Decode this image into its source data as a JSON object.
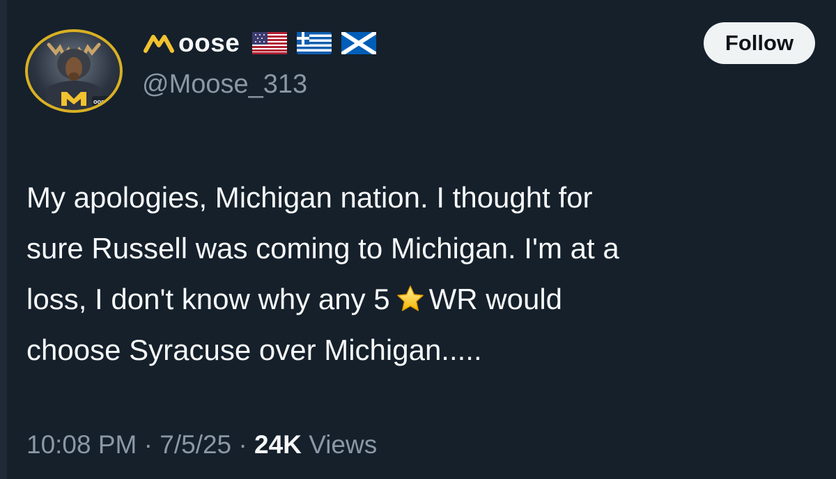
{
  "profile": {
    "display_name": "oose",
    "handle": "@Moose_313",
    "avatar_label": "oose",
    "flags": [
      "us-flag-icon",
      "greece-flag-icon",
      "scotland-flag-icon"
    ]
  },
  "follow_button": {
    "label": "Follow"
  },
  "tweet": {
    "lines": [
      "My apologies, Michigan nation. I thought for",
      "sure Russell was coming to Michigan. I'm at a",
      "loss, I don't know why any 5",
      "WR would",
      "choose Syracuse over Michigan....."
    ],
    "star_icon": "star-emoji-icon"
  },
  "meta": {
    "time": "10:08 PM",
    "separator": "·",
    "date": "7/5/25",
    "views_count": "24K",
    "views_label": "Views"
  },
  "colors": {
    "background": "#15202b",
    "text": "#f7f9f9",
    "secondary_text": "#8b98a5",
    "follow_bg": "#eff3f4",
    "m_logo": "#f2c230",
    "avatar_ring": "#d9b024"
  }
}
